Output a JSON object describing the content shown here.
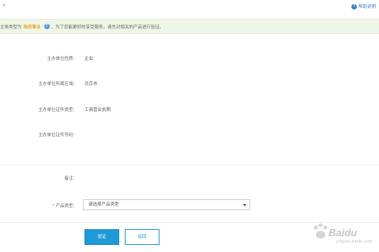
{
  "topbar": {
    "back_glyph": "<",
    "help_label": "帮助说明"
  },
  "notice": {
    "prefix": "主体类型为",
    "highlight": "政府事业",
    "suffix": "，为了您能更好的享受服务，请先对相关的产品进行验证。"
  },
  "fields": [
    {
      "label": "主办单位性质：",
      "value": "企业"
    },
    {
      "label": "主办单位所属区域：",
      "value": "北京市"
    },
    {
      "label": "主办单位证件类型：",
      "value": "工商营业执照"
    },
    {
      "label": "主办单位证件号码：",
      "value": ""
    }
  ],
  "product_section": {
    "remark_label": "备注：",
    "product_label": "产品类型：",
    "select_placeholder": "请选择产品类型"
  },
  "buttons": {
    "confirm": "验证",
    "back": "返回"
  },
  "watermark": {
    "text1": "Baidu",
    "text2": "jingyan.baidu.com"
  },
  "colors": {
    "accent": "#1e9ad6",
    "notice_bg": "#eef6e6",
    "highlight": "#e4a93c",
    "required": "#e0463c"
  }
}
